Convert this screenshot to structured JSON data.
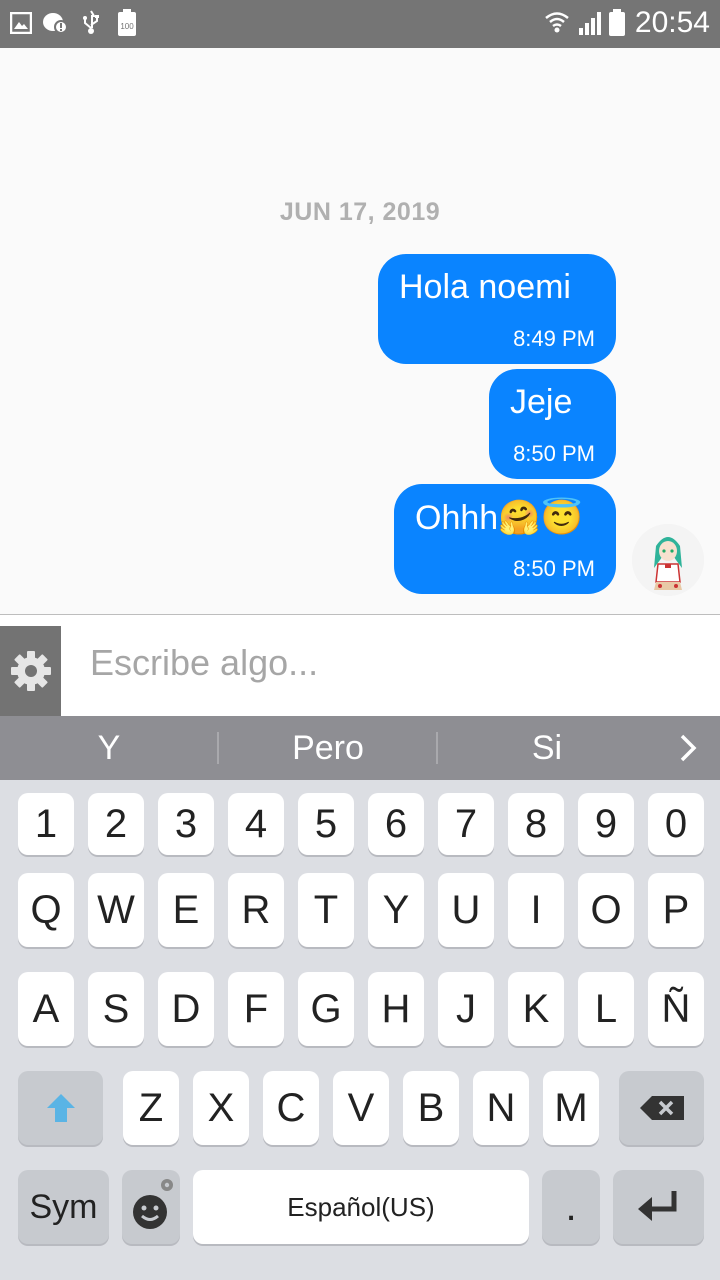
{
  "status_bar": {
    "time": "20:54",
    "battery_level_label": "100",
    "icons": [
      "gallery-icon",
      "notification-alert-icon",
      "usb-icon",
      "battery-full-icon",
      "wifi-icon",
      "signal-icon",
      "battery-icon"
    ]
  },
  "chat": {
    "date_separator": "JUN 17, 2019",
    "messages": [
      {
        "text": "Hola noemi",
        "time": "8:49 PM",
        "direction": "outgoing"
      },
      {
        "text": "Jeje",
        "time": "8:50 PM",
        "direction": "outgoing"
      },
      {
        "text": "Ohhh🤗😇",
        "time": "8:50 PM",
        "direction": "outgoing"
      }
    ],
    "bubble_color": "#0a84ff"
  },
  "composer": {
    "settings_icon": "gear-icon",
    "placeholder": "Escribe algo..."
  },
  "keyboard": {
    "suggestions": [
      "Y",
      "Pero",
      "Si"
    ],
    "number_row": [
      "1",
      "2",
      "3",
      "4",
      "5",
      "6",
      "7",
      "8",
      "9",
      "0"
    ],
    "row1": [
      "Q",
      "W",
      "E",
      "R",
      "T",
      "Y",
      "U",
      "I",
      "O",
      "P"
    ],
    "row2": [
      "A",
      "S",
      "D",
      "F",
      "G",
      "H",
      "J",
      "K",
      "L",
      "Ñ"
    ],
    "row3": [
      "Z",
      "X",
      "C",
      "V",
      "B",
      "N",
      "M"
    ],
    "sym_label": "Sym",
    "space_label": "Español(US)",
    "period_label": ".",
    "accent_color": "#5ab4e5"
  }
}
